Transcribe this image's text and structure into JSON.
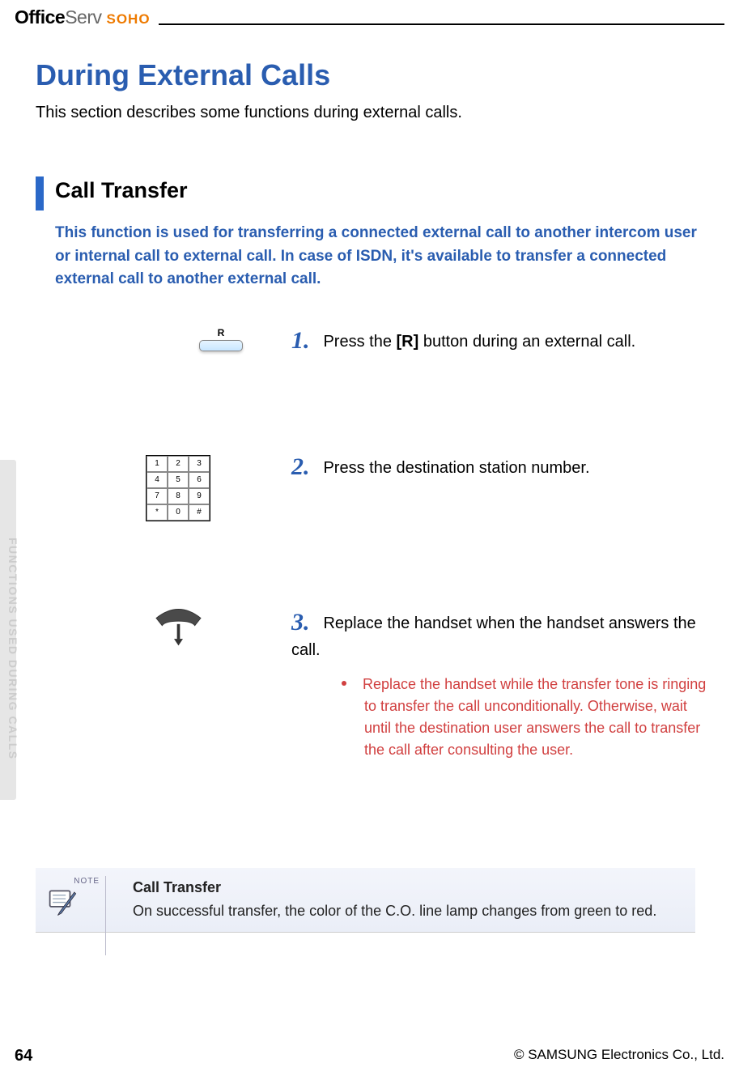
{
  "header": {
    "logo_office": "Office",
    "logo_serv": "Serv",
    "logo_soho": "SOHO"
  },
  "title": "During External Calls",
  "intro": "This section describes some functions during external calls.",
  "section": {
    "title": "Call Transfer",
    "description": "This function is used for transferring a connected external call to another intercom user or internal call to external call. In case of ISDN, it's available to transfer a connected external call to another external call."
  },
  "steps": {
    "step1": {
      "num": "1.",
      "text_prefix": "Press the ",
      "text_bold": "[R]",
      "text_suffix": " button during an external call.",
      "icon_label": "R"
    },
    "step2": {
      "num": "2.",
      "text": "Press the destination station number.",
      "keypad": [
        "1",
        "2",
        "3",
        "4",
        "5",
        "6",
        "7",
        "8",
        "9",
        "*",
        "0",
        "#"
      ]
    },
    "step3": {
      "num": "3.",
      "text": "Replace the handset when the handset answers the call.",
      "bullet": "Replace the handset while the transfer tone is ringing to transfer the call unconditionally. Otherwise, wait until the destination user answers the call to transfer the call after consulting the user."
    }
  },
  "note": {
    "label": "NOTE",
    "title": "Call Transfer",
    "body": "On successful transfer, the color of the C.O. line lamp changes from green to red."
  },
  "sidebar": {
    "text": "FUNCTIONS USED DURING CALLS"
  },
  "footer": {
    "page": "64",
    "copyright": "© SAMSUNG Electronics Co., Ltd."
  }
}
